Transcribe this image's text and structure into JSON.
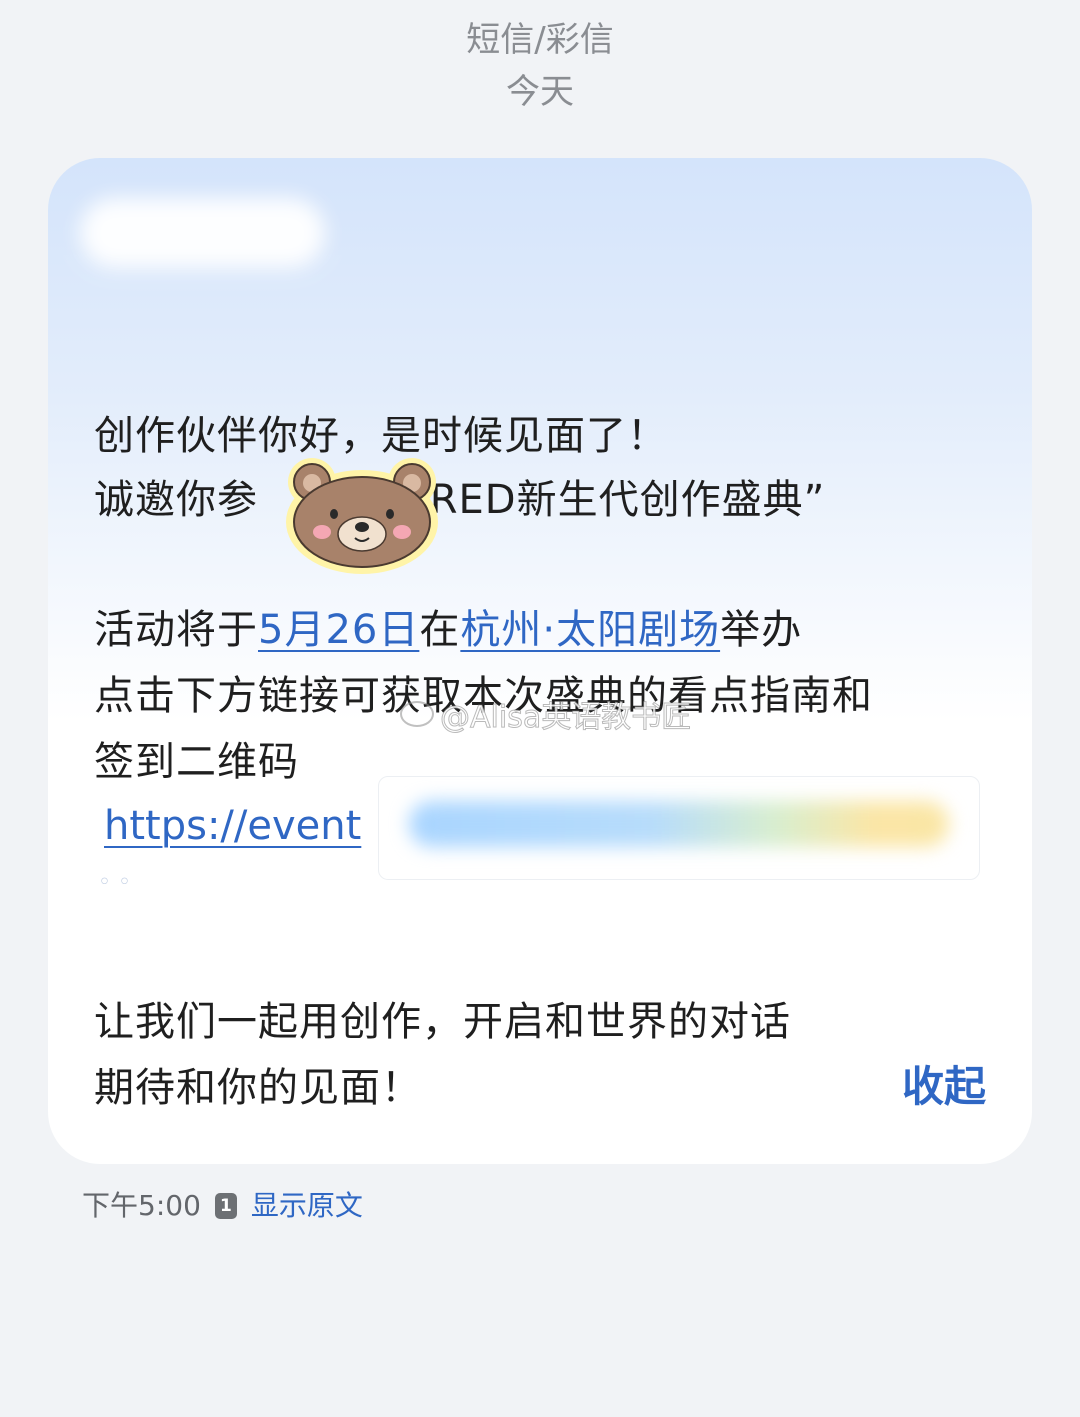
{
  "header": {
    "channel": "短信/彩信",
    "date": "今天"
  },
  "message": {
    "line1": "创作伙伴你好，是时候见面了！",
    "line2_a": "诚邀你参",
    "line2_b": "“RED新生代创作盛典”",
    "line3_a": "活动将于",
    "line3_date": "5月26日",
    "line3_b": "在",
    "line3_location": "杭州·太阳剧场",
    "line3_c": "举办",
    "line4": "点击下方链接可获取本次盛典的看点指南和",
    "line5": "签到二维码",
    "url_visible": "https://event",
    "line6": "让我们一起用创作，开启和世界的对话",
    "line7": "期待和你的见面！",
    "collapse_label": "收起"
  },
  "footer": {
    "time": "下午5:00",
    "sim_slot": "1",
    "show_original": "显示原文"
  },
  "watermark": "@Alisa英语教书匠",
  "colors": {
    "link": "#2f67c4",
    "background": "#f1f3f6",
    "bubble_top": "#d4e4fb",
    "muted_text": "#8a8d92"
  },
  "icons": {
    "sticker": "bear-sticker-icon",
    "sim": "sim-slot-icon"
  }
}
